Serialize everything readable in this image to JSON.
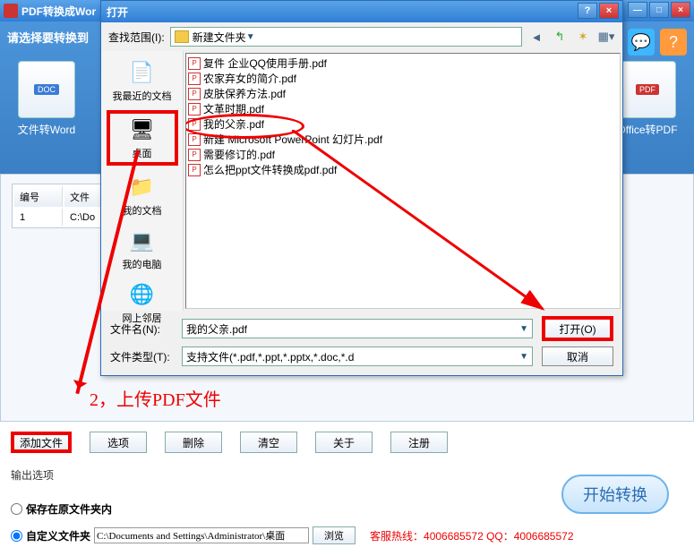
{
  "main_window": {
    "title": "PDF转换成Wor",
    "prompt": "请选择要转换到",
    "tiles": {
      "left": {
        "label": "文件转Word",
        "badge": "DOC"
      },
      "right": {
        "label": "Office转PDF",
        "badge": "PDF"
      }
    },
    "table": {
      "cols": [
        "编号",
        "文件"
      ],
      "rows": [
        {
          "num": "1",
          "file": "C:\\Do"
        }
      ]
    },
    "buttons": {
      "add": "添加文件",
      "options": "选项",
      "delete": "删除",
      "clear": "清空",
      "about": "关于",
      "register": "注册"
    },
    "output_label": "输出选项",
    "radio1": "保存在原文件夹内",
    "radio2": "自定义文件夹",
    "path_value": "C:\\Documents and Settings\\Administrator\\桌面",
    "browse": "浏览",
    "hotline": "客服热线：4006685572 QQ：4006685572",
    "start": "开始转换"
  },
  "dialog": {
    "title": "打开",
    "lookin_label": "查找范围(I):",
    "lookin_value": "新建文件夹",
    "places": {
      "recent": "我最近的文档",
      "desktop": "桌面",
      "mydocs": "我的文档",
      "mycomp": "我的电脑",
      "network": "网上邻居"
    },
    "files": [
      "复件 企业QQ使用手册.pdf",
      "农家弃女的简介.pdf",
      "皮肤保养方法.pdf",
      "文革时期.pdf",
      "我的父亲.pdf",
      "新建 Microsoft PowerPoint 幻灯片.pdf",
      "需要修订的.pdf",
      "怎么把ppt文件转换成pdf.pdf"
    ],
    "filename_label": "文件名(N):",
    "filename_value": "我的父亲.pdf",
    "filetype_label": "文件类型(T):",
    "filetype_value": "支持文件(*.pdf,*.ppt,*.pptx,*.doc,*.d",
    "open_btn": "打开(O)",
    "cancel_btn": "取消"
  },
  "annotation": "2，上传PDF文件"
}
